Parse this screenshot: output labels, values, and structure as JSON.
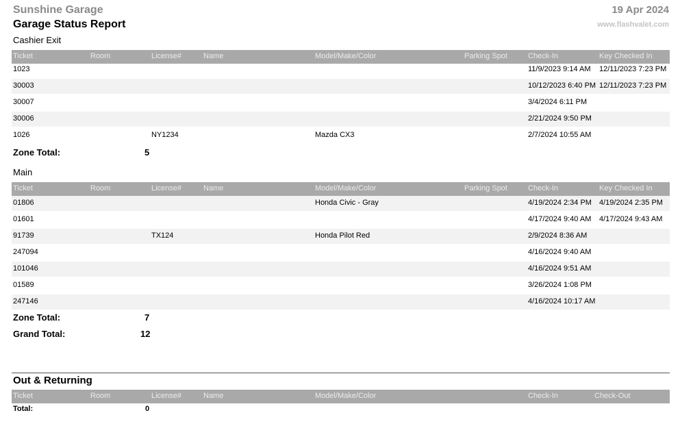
{
  "header": {
    "company": "Sunshine Garage",
    "title": "Garage Status Report",
    "date": "19 Apr 2024",
    "website": "www.flashvalet.com"
  },
  "columns": {
    "ticket": "Ticket",
    "room": "Room",
    "license": "License#",
    "name": "Name",
    "model": "Model/Make/Color",
    "spot": "Parking Spot",
    "checkin": "Check-In",
    "key": "Key Checked In",
    "checkout": "Check-Out"
  },
  "zones": [
    {
      "name": "Cashier Exit",
      "rows": [
        {
          "ticket": "1023",
          "license": "",
          "model": "",
          "checkin": "11/9/2023 9:14 AM",
          "key": "12/11/2023 7:23 PM"
        },
        {
          "ticket": "30003",
          "license": "",
          "model": "",
          "checkin": "10/12/2023 6:40 PM",
          "key": "12/11/2023 7:23 PM"
        },
        {
          "ticket": "30007",
          "license": "",
          "model": "",
          "checkin": "3/4/2024 6:11 PM",
          "key": ""
        },
        {
          "ticket": "30006",
          "license": "",
          "model": "",
          "checkin": "2/21/2024 9:50 PM",
          "key": ""
        },
        {
          "ticket": "1026",
          "license": "NY1234",
          "model": "Mazda CX3",
          "checkin": "2/7/2024 10:55 AM",
          "key": ""
        }
      ],
      "total_label": "Zone Total:",
      "total": "5"
    },
    {
      "name": "Main",
      "rows": [
        {
          "ticket": "01806",
          "license": "",
          "model": "Honda Civic - Gray",
          "checkin": "4/19/2024 2:34 PM",
          "key": "4/19/2024 2:35 PM"
        },
        {
          "ticket": "01601",
          "license": "",
          "model": "",
          "checkin": "4/17/2024 9:40 AM",
          "key": "4/17/2024 9:43 AM"
        },
        {
          "ticket": "91739",
          "license": "TX124",
          "model": "Honda Pilot Red",
          "checkin": "2/9/2024 8:36 AM",
          "key": ""
        },
        {
          "ticket": "247094",
          "license": "",
          "model": "",
          "checkin": "4/16/2024 9:40 AM",
          "key": ""
        },
        {
          "ticket": "101046",
          "license": "",
          "model": "",
          "checkin": "4/16/2024 9:51 AM",
          "key": ""
        },
        {
          "ticket": "01589",
          "license": "",
          "model": "",
          "checkin": "3/26/2024 1:08 PM",
          "key": ""
        },
        {
          "ticket": "247146",
          "license": "",
          "model": "",
          "checkin": "4/16/2024 10:17 AM",
          "key": ""
        }
      ],
      "total_label": "Zone Total:",
      "total": "7"
    }
  ],
  "grand_total_label": "Grand Total:",
  "grand_total": "12",
  "out_returning": {
    "title": "Out & Returning",
    "total_label": "Total:",
    "total": "0"
  }
}
